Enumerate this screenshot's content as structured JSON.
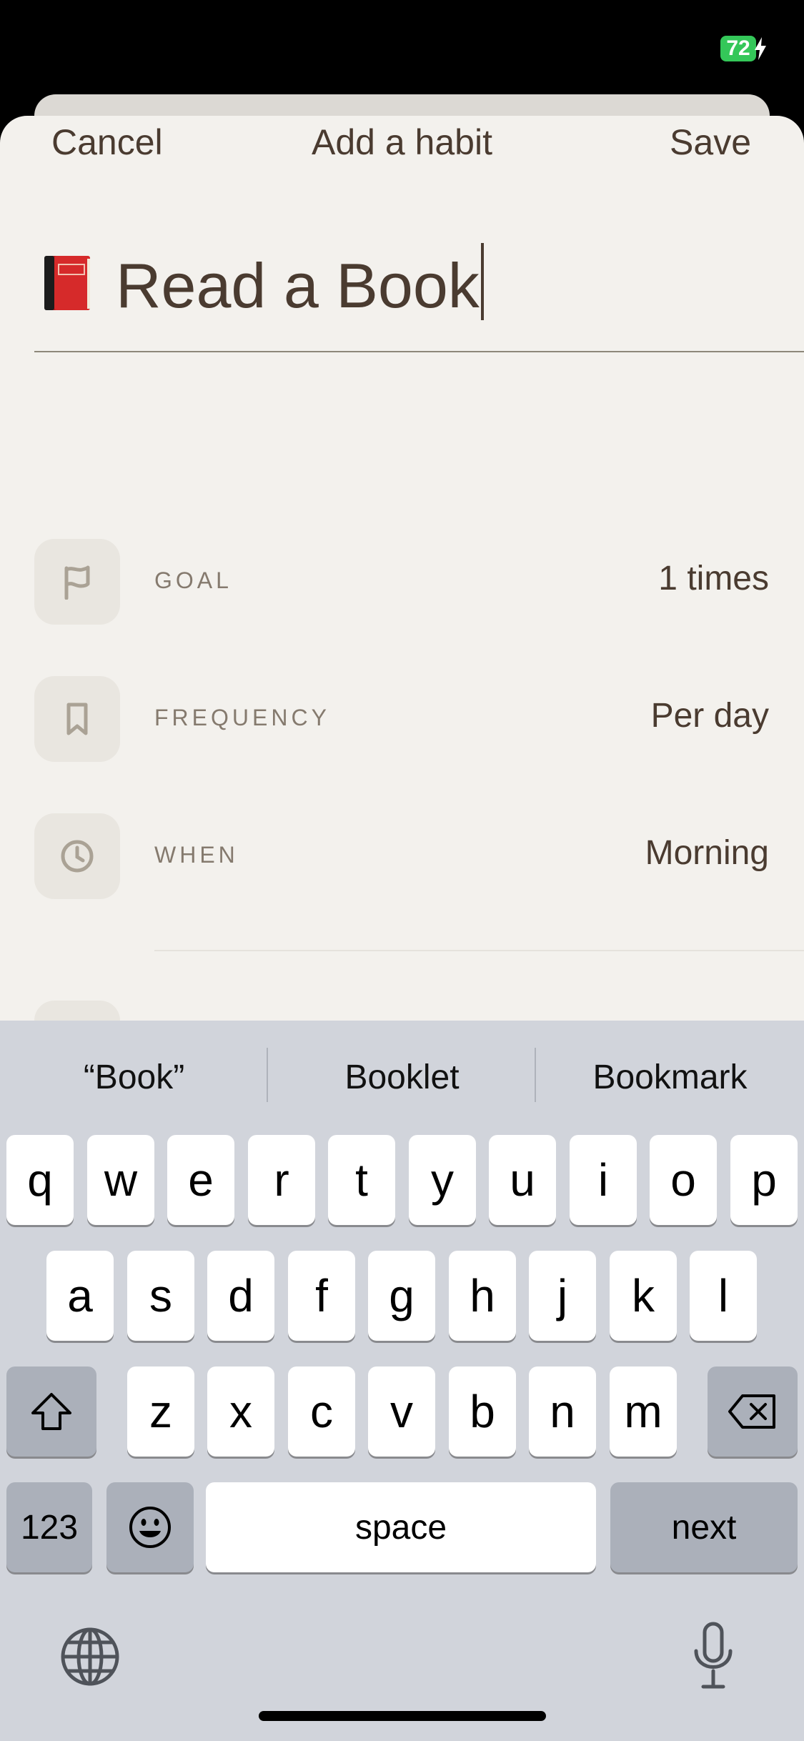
{
  "status_bar": {
    "battery_level": "72",
    "battery_color": "#34c759",
    "charging": true
  },
  "nav": {
    "cancel_label": "Cancel",
    "title": "Add a habit",
    "save_label": "Save"
  },
  "habit": {
    "emoji_icon": "red-book-icon",
    "name": "Read a Book"
  },
  "options": [
    {
      "icon": "flag-icon",
      "label": "GOAL",
      "value": "1 times"
    },
    {
      "icon": "bookmark-icon",
      "label": "FREQUENCY",
      "value": "Per day"
    },
    {
      "icon": "clock-icon",
      "label": "WHEN",
      "value": "Morning"
    }
  ],
  "keyboard": {
    "suggestions": [
      "“Book”",
      "Booklet",
      "Bookmark"
    ],
    "row1": [
      "q",
      "w",
      "e",
      "r",
      "t",
      "y",
      "u",
      "i",
      "o",
      "p"
    ],
    "row2": [
      "a",
      "s",
      "d",
      "f",
      "g",
      "h",
      "j",
      "k",
      "l"
    ],
    "row3": [
      "z",
      "x",
      "c",
      "v",
      "b",
      "n",
      "m"
    ],
    "numbers_label": "123",
    "space_label": "space",
    "next_label": "next",
    "icons": {
      "shift": "shift-icon",
      "delete": "delete-icon",
      "emoji": "emoji-icon",
      "globe": "globe-icon",
      "mic": "microphone-icon"
    }
  },
  "colors": {
    "text_primary": "#4a3b30",
    "sheet_bg": "#f3f1ed",
    "keyboard_bg": "#d1d4db"
  }
}
